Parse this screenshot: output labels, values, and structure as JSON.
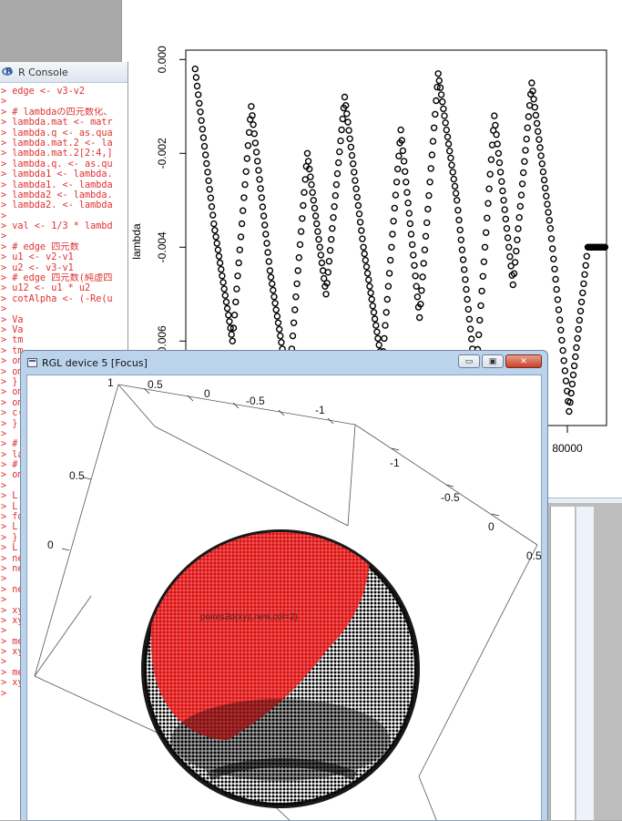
{
  "console": {
    "title": "R Console",
    "lines": [
      "> edge <- v3-v2",
      ">",
      "> # lambdaの四元数化、",
      "> lambda.mat <- matr",
      "> lambda.q <- as.qua",
      "> lambda.mat.2 <- la",
      "> lambda.mat.2[2:4,]",
      "> lambda.q. <- as.qu",
      "> lambda1 <- lambda.",
      "> lambda1. <- lambda",
      "> lambda2 <- lambda.",
      "> lambda2. <- lambda",
      ">",
      "> val <- 1/3 * lambd",
      ">",
      "> # edge 四元数",
      "> u1 <- v2-v1",
      "> u2 <- v3-v1",
      "> # edge 四元数(純虚四",
      "> u12 <- u1 * u2",
      "> cotAlpha <- (-Re(u",
      ">",
      "> Va",
      "> Va",
      "> tm",
      "> tm",
      "> om",
      "> om",
      "> }",
      "> om",
      "> om",
      "> c(",
      "> }",
      ">",
      "> #",
      "> la",
      "> #",
      "> om",
      ">",
      "> L.",
      "> L.",
      "> fo",
      "> L.",
      "> }",
      "> L.",
      "> ne",
      "> ne",
      ">",
      "> ne",
      ">",
      "> xy",
      "> xy",
      ">",
      "> me",
      "> xy",
      ">",
      "> me",
      "> xy",
      ">"
    ]
  },
  "plot": {
    "ylabel": "lambda",
    "y_ticks": [
      "0.000",
      "-0.002",
      "-0.004",
      "-0.006"
    ],
    "x_tick_visible": "80000"
  },
  "chart_data": {
    "type": "scatter",
    "title": "",
    "xlabel": "",
    "ylabel": "lambda",
    "xlim": [
      0,
      90000
    ],
    "ylim": [
      -0.0078,
      0.0002
    ],
    "marker": "open-circle",
    "color": "#000000",
    "series": [
      {
        "x": [
          2000,
          6000,
          10000,
          14000,
          18000,
          22000,
          26000,
          30000,
          34000,
          38000,
          42000,
          46000,
          50000,
          54000,
          58000,
          62000,
          66000,
          70000,
          74000,
          78000,
          82000,
          86000
        ],
        "values": [
          -0.0002,
          -0.0035,
          -0.006,
          -0.001,
          -0.0045,
          -0.007,
          -0.002,
          -0.005,
          -0.0008,
          -0.004,
          -0.0065,
          -0.0015,
          -0.0055,
          -0.0003,
          -0.003,
          -0.0068,
          -0.0012,
          -0.0048,
          -0.0005,
          -0.0036,
          -0.0075,
          -0.004
        ]
      }
    ]
  },
  "rgl": {
    "title": "RGL device 5 [Focus]",
    "minimize": "▭",
    "maximize": "▣",
    "close": "✕",
    "axis_labels_top": [
      "1",
      "0.5",
      "0",
      "-0.5",
      "-1"
    ],
    "axis_labels_right": [
      "-1",
      "-0.5",
      "0",
      "0.5"
    ],
    "axis_labels_left": [
      "0.5",
      "0"
    ],
    "sphere_text": "points3d(xyz.new,col=2)",
    "colors": {
      "red": "#dd1010",
      "black": "#000000"
    }
  }
}
